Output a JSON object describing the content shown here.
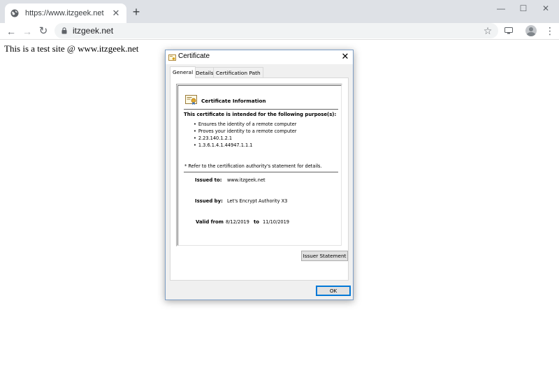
{
  "browser": {
    "tab": {
      "title": "https://www.itzgeek.net",
      "close_symbol": "✕"
    },
    "new_tab_symbol": "+",
    "window_controls": {
      "minimize": "—",
      "maximize": "☐",
      "close": "✕"
    },
    "nav": {
      "back": "←",
      "forward": "→",
      "reload": "↻"
    },
    "address_bar": {
      "url": "itzgeek.net",
      "bookmark_symbol": "☆"
    },
    "menu_symbol": "⋮"
  },
  "page": {
    "body_text": "This is a test site @ www.itzgeek.net"
  },
  "dialog": {
    "title": "Certificate",
    "close_symbol": "✕",
    "tabs": [
      {
        "label": "General",
        "active": true
      },
      {
        "label": "Details",
        "active": false
      },
      {
        "label": "Certification Path",
        "active": false
      }
    ],
    "info": {
      "heading": "Certificate Information",
      "purpose_intro": "This certificate is intended for the following purpose(s):",
      "purposes": [
        "Ensures the identity of a remote computer",
        "Proves your identity to a remote computer",
        "2.23.140.1.2.1",
        "1.3.6.1.4.1.44947.1.1.1"
      ],
      "note": "* Refer to the certification authority's statement for details.",
      "issued_to_label": "Issued to:",
      "issued_to_value": "www.itzgeek.net",
      "issued_by_label": "Issued by:",
      "issued_by_value": "Let's Encrypt Authority X3",
      "valid_from_label": "Valid from",
      "valid_from_value": "8/12/2019",
      "valid_to_label": "to",
      "valid_to_value": "11/10/2019"
    },
    "buttons": {
      "issuer_statement": "Issuer Statement",
      "ok": "OK"
    }
  },
  "colors": {
    "tabstrip_bg": "#dee1e6",
    "omnibox_bg": "#f1f3f4",
    "dialog_bg": "#f0f0f0",
    "dialog_border": "#7e9ec4",
    "ok_button_focus": "#0078d7"
  },
  "icons": {
    "tab_favicon": "globe-icon",
    "address_bar": "lock-icon",
    "bookmark": "star-icon",
    "cast": "cast-icon",
    "profile": "avatar-icon",
    "dialog_title": "certificate-icon",
    "info_header": "certificate-icon"
  }
}
